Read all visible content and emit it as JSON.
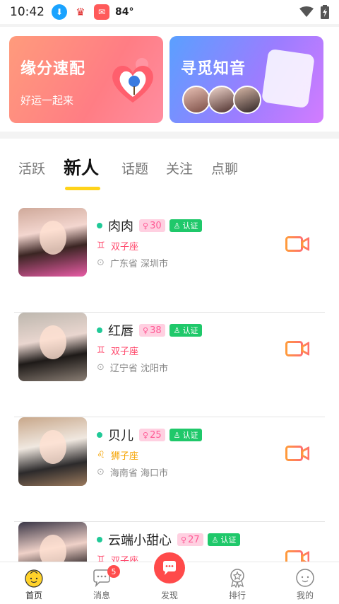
{
  "status_bar": {
    "time": "10:42",
    "temperature": "84°"
  },
  "banners": {
    "left": {
      "title": "缘分速配",
      "subtitle": "好运一起来"
    },
    "right": {
      "title": "寻觅知音"
    }
  },
  "tabs": [
    {
      "label": "活跃"
    },
    {
      "label": "新人"
    },
    {
      "label": "话题"
    },
    {
      "label": "关注"
    },
    {
      "label": "点聊"
    }
  ],
  "active_tab": "新人",
  "users": [
    {
      "name": "肉肉",
      "age": "30",
      "cert": "认证",
      "zodiac": "双子座",
      "location": "广东省 深圳市",
      "online": true
    },
    {
      "name": "红唇",
      "age": "38",
      "cert": "认证",
      "zodiac": "双子座",
      "location": "辽宁省 沈阳市",
      "online": true
    },
    {
      "name": "贝儿",
      "age": "25",
      "cert": "认证",
      "zodiac": "狮子座",
      "location": "海南省 海口市",
      "online": true
    },
    {
      "name": "云端小甜心",
      "age": "27",
      "cert": "认证",
      "zodiac": "双子座",
      "location": "",
      "online": true
    }
  ],
  "bottom_nav": [
    {
      "label": "首页",
      "icon": "home-face-icon",
      "active": true
    },
    {
      "label": "消息",
      "icon": "chat-bubble-icon",
      "badge": "5"
    },
    {
      "label": "发现",
      "icon": "discover-icon"
    },
    {
      "label": "排行",
      "icon": "ranking-icon"
    },
    {
      "label": "我的",
      "icon": "profile-face-icon"
    }
  ],
  "colors": {
    "online": "#20c997",
    "age_badge": "#ffd0e1",
    "cert_badge": "#1fc86a",
    "tab_underline": "#ffd31a",
    "accent_red": "#ff4a4a"
  }
}
